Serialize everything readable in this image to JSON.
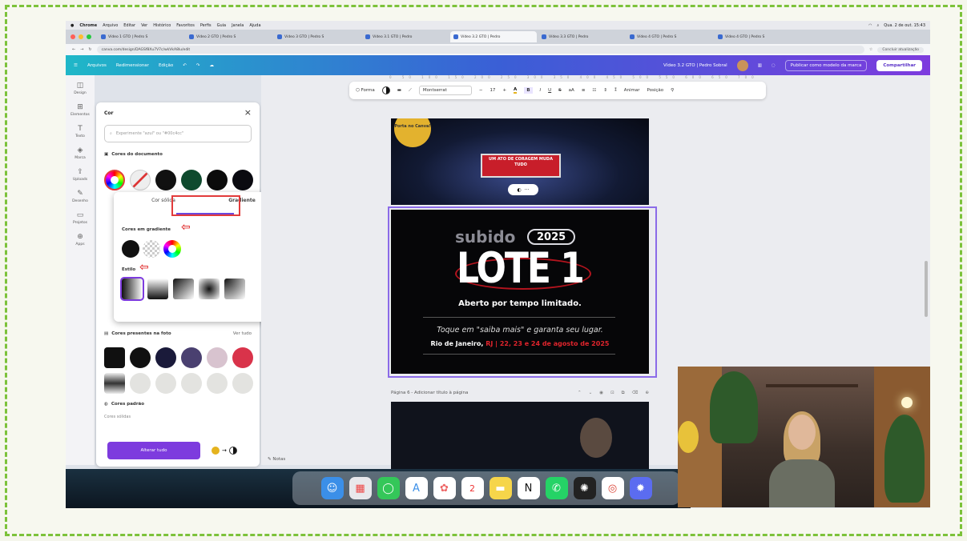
{
  "menubar": {
    "app": "Chrome",
    "items": [
      "Arquivo",
      "Editar",
      "Ver",
      "Histórico",
      "Favoritos",
      "Perfis",
      "Guia",
      "Janela",
      "Ajuda"
    ],
    "datetime": "Qua. 2 de out. 15:43"
  },
  "tabs": [
    "Vídeo 1 GTO | Pedro S",
    "Vídeo 2 GTO | Pedro S",
    "Vídeo 3 GTO | Pedro S",
    "Vídeo 3.1 GTO | Pedro",
    "Vídeo 3.2 GTO | Pedro",
    "Vídeo 3.3 GTO | Pedro",
    "Vídeo 4 GTO | Pedro S",
    "Vídeo 4 GTO | Pedro S"
  ],
  "browser": {
    "url": "canva.com/design/DAGSf8Xu7V7c/wkVkA8lu/edit",
    "finish_label": "Concluir atualização"
  },
  "canva": {
    "menu": [
      "Arquivos",
      "Redimensionar",
      "Edição"
    ],
    "doc_title": "Vídeo 3.2 GTO | Pedro Sobral",
    "publish_label": "Publicar como modelo da marca",
    "share_label": "Compartilhar"
  },
  "rail": [
    {
      "label": "Design",
      "glyph": "◫"
    },
    {
      "label": "Elementos",
      "glyph": "⊞"
    },
    {
      "label": "Texto",
      "glyph": "T"
    },
    {
      "label": "Marca",
      "glyph": "◈"
    },
    {
      "label": "Uploads",
      "glyph": "⇪"
    },
    {
      "label": "Desenho",
      "glyph": "✎"
    },
    {
      "label": "Projetos",
      "glyph": "▭"
    },
    {
      "label": "Apps",
      "glyph": "⊕"
    }
  ],
  "color_panel": {
    "title": "Cor",
    "search_placeholder": "Experimente \"azul\" ou \"#00c4cc\"",
    "doc_colors_label": "Cores do documento",
    "doc_colors": [
      "#111111",
      "#0f4a2e",
      "#0b0b0b",
      "#0a0a10"
    ],
    "photo_colors_label": "Cores presentes na foto",
    "see_all": "Ver tudo",
    "photo_colors": [
      "#101010",
      "#1a1a3a",
      "#4a4070",
      "#d8c3cf",
      "#d9334a"
    ],
    "default_colors_label": "Cores padrão",
    "solid_label": "Cores sólidas",
    "apply_all": "Alterar tudo"
  },
  "gradient_popup": {
    "tab_solid": "Cor sólida",
    "tab_gradient": "Gradiente",
    "gradient_colors_label": "Cores em gradiente",
    "style_label": "Estilo"
  },
  "toolbar": {
    "shape": "Forma",
    "font": "Montserrat",
    "font_size": "17",
    "animate": "Animar",
    "position": "Posição"
  },
  "design": {
    "badge": "Porta no Canva!",
    "stage_text": "UM ATO DE CORAGEM MUDA TUDO",
    "subido": "subido",
    "year": "2025",
    "lote": "LOTE 1",
    "aberto": "Aberto por tempo limitado.",
    "toque": "Toque em \"saiba mais\" e garanta seu lugar.",
    "rio_a": "Rio de Janeiro,",
    "rio_b": "RJ | 22, 23 e 24 de agosto de 2025"
  },
  "page_bar": {
    "label": "Página 6 - Adicionar título à página"
  },
  "notes_label": "Notas",
  "accent": "#7d3bde"
}
